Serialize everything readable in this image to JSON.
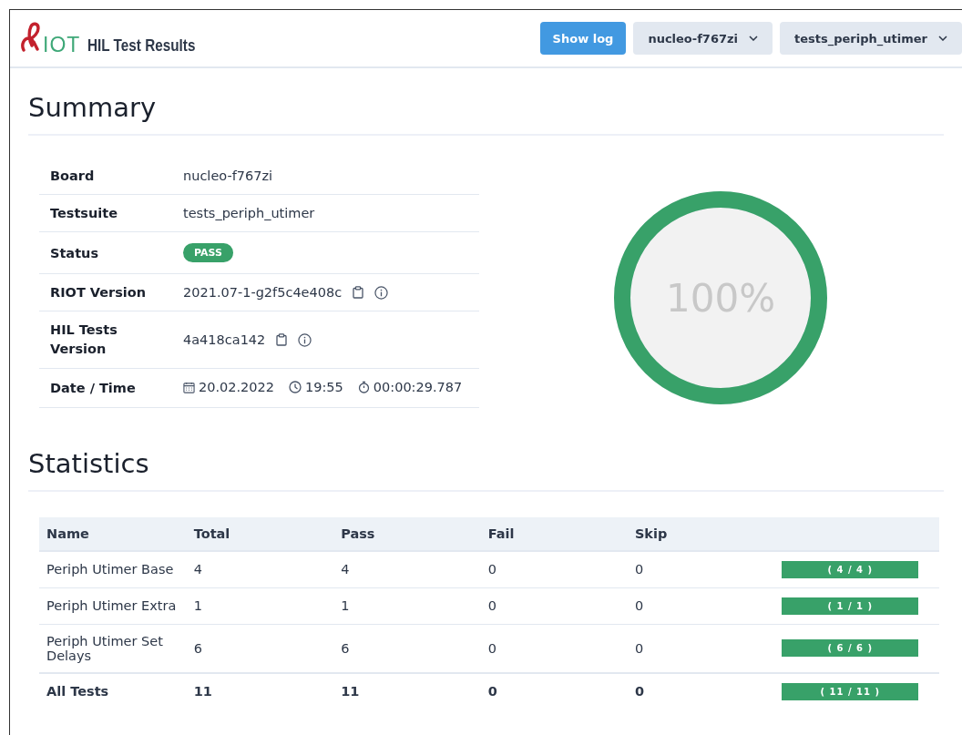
{
  "header": {
    "logo_text": "IOT",
    "title": "HIL Test Results",
    "buttons": [
      {
        "label": "Show log",
        "kind": "primary"
      },
      {
        "label": "nucleo-f767zi",
        "kind": "dropdown"
      },
      {
        "label": "tests_periph_utimer",
        "kind": "dropdown"
      }
    ]
  },
  "summary": {
    "title": "Summary",
    "rows": [
      {
        "label": "Board",
        "kind": "text",
        "value": "nucleo-f767zi"
      },
      {
        "label": "Testsuite",
        "kind": "text",
        "value": "tests_periph_utimer"
      },
      {
        "label": "Status",
        "kind": "badge",
        "value": "PASS",
        "color": "#38a169"
      },
      {
        "label": "RIOT Version",
        "kind": "version",
        "value": "2021.07-1-g2f5c4e408c"
      },
      {
        "label": "HIL Tests Version",
        "kind": "version",
        "value": "4a418ca142"
      },
      {
        "label": "Date / Time",
        "kind": "datetime",
        "date": "20.02.2022",
        "time": "19:55",
        "duration": "00:00:29.787"
      }
    ],
    "donut": {
      "text": "100%"
    }
  },
  "statistics": {
    "title": "Statistics",
    "columns": [
      "Name",
      "Total",
      "Pass",
      "Fail",
      "Skip"
    ],
    "rows": [
      {
        "kind": "test",
        "name": "Periph Utimer Base",
        "total": "4",
        "pass": "4",
        "fail": "0",
        "skip": "0",
        "level": 1,
        "bar_text": "( 4 / 4 )"
      },
      {
        "kind": "test",
        "name": "Periph Utimer Extra",
        "total": "1",
        "pass": "1",
        "fail": "0",
        "skip": "0",
        "level": 1,
        "bar_text": "( 1 / 1 )"
      },
      {
        "kind": "test",
        "name": "Periph Utimer Set Delays",
        "total": "6",
        "pass": "6",
        "fail": "0",
        "skip": "0",
        "level": 1,
        "bar_text": "( 6 / 6 )"
      },
      {
        "kind": "total",
        "name": "All Tests",
        "total": "11",
        "pass": "11",
        "fail": "0",
        "skip": "0",
        "level": 1,
        "bar_text": "( 11 / 11 )"
      }
    ]
  }
}
